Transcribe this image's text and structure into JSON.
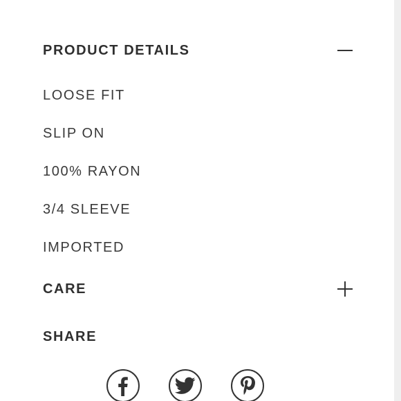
{
  "product_details": {
    "title": "PRODUCT DETAILS",
    "expanded": true,
    "toggle_icon": "minus-icon",
    "items": [
      "LOOSE FIT",
      "SLIP ON",
      "100% RAYON",
      "3/4 SLEEVE",
      "IMPORTED"
    ]
  },
  "care": {
    "title": "CARE",
    "expanded": false,
    "toggle_icon": "plus-icon"
  },
  "share": {
    "title": "SHARE",
    "networks": [
      "facebook-icon",
      "twitter-icon",
      "pinterest-icon"
    ]
  },
  "colors": {
    "text": "#333333",
    "background": "#ffffff",
    "edge": "#efefef"
  }
}
